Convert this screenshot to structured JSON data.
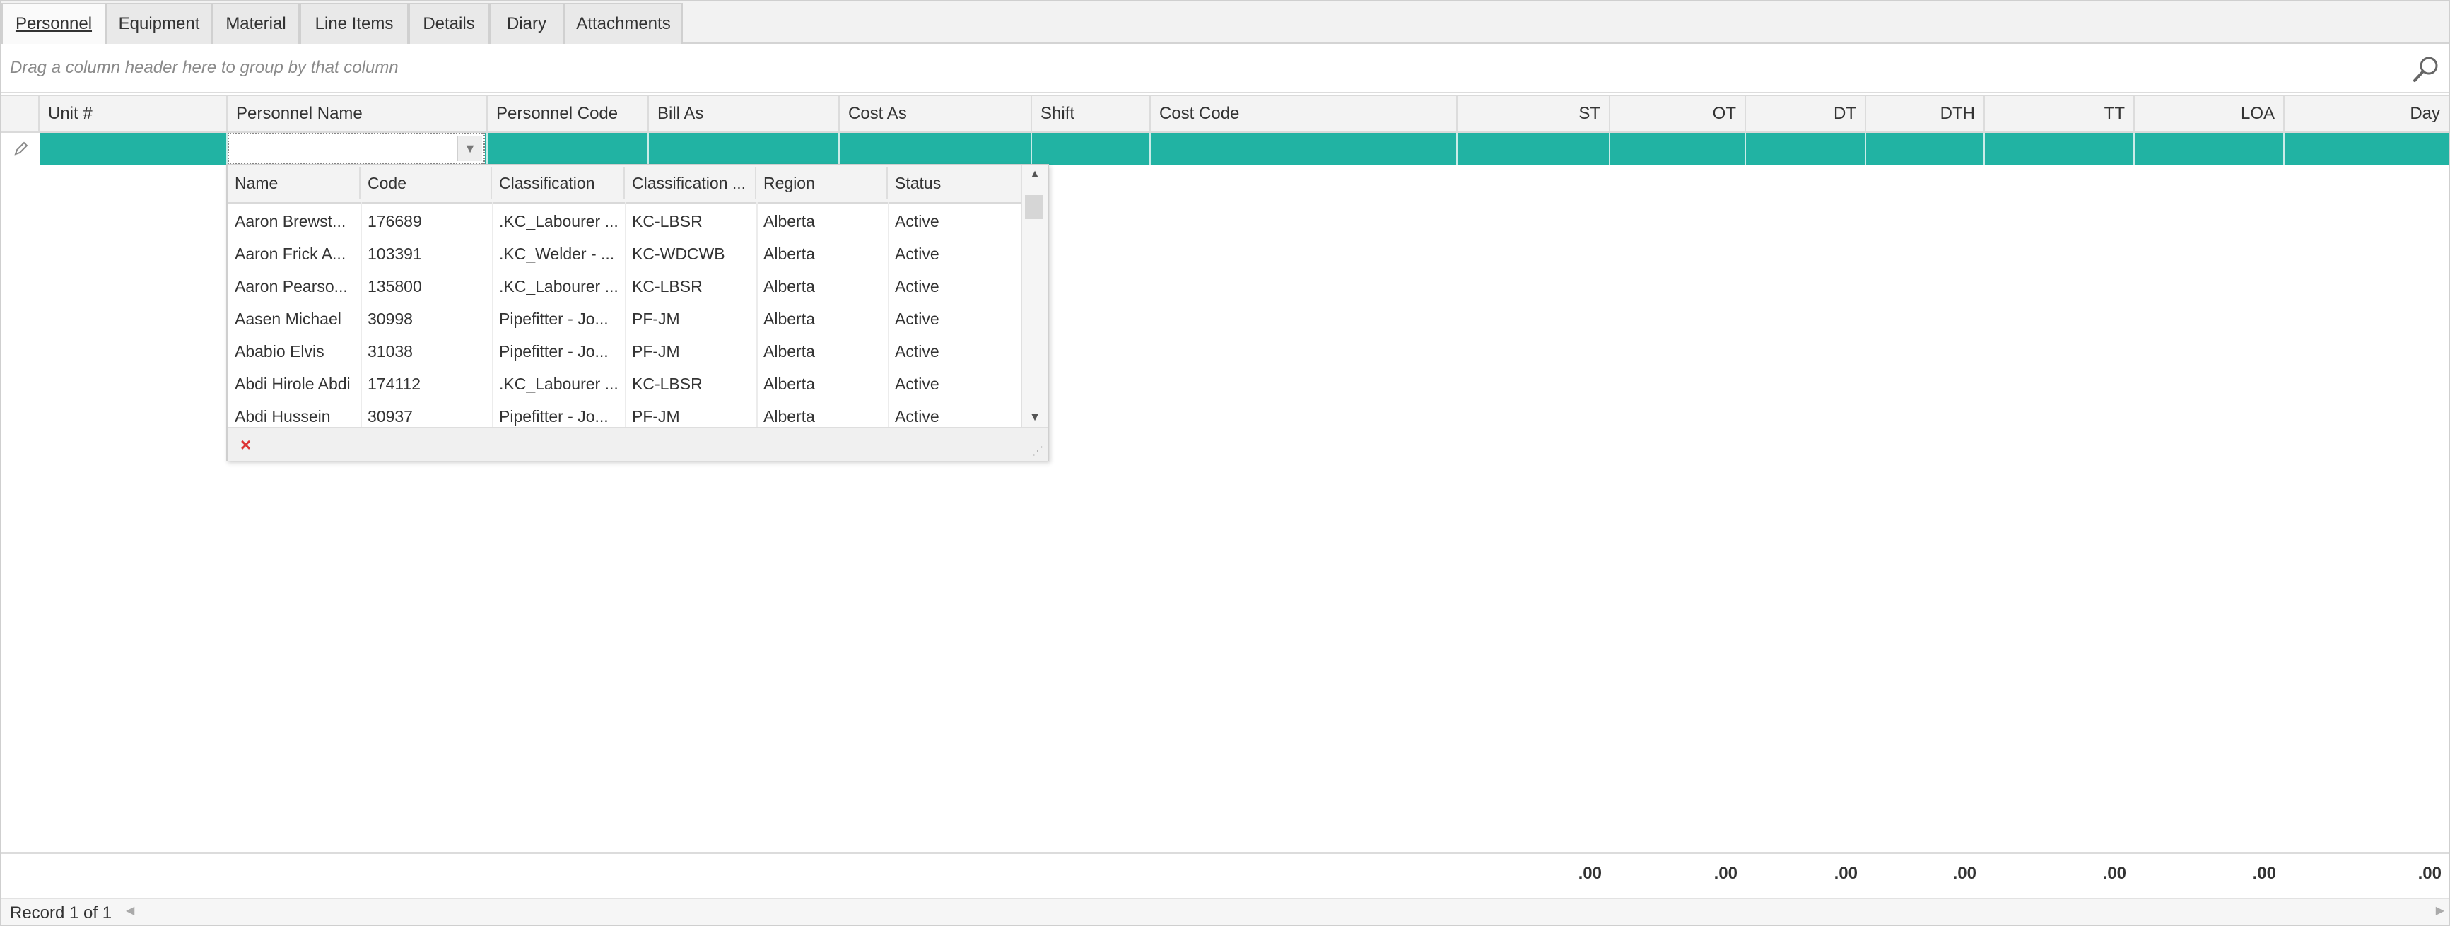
{
  "tabs": [
    {
      "label": "Personnel",
      "active": true
    },
    {
      "label": "Equipment",
      "active": false
    },
    {
      "label": "Material",
      "active": false
    },
    {
      "label": "Line Items",
      "active": false
    },
    {
      "label": "Details",
      "active": false
    },
    {
      "label": "Diary",
      "active": false
    },
    {
      "label": "Attachments",
      "active": false
    }
  ],
  "group_panel": {
    "hint": "Drag a column header here to group by that column"
  },
  "grid": {
    "columns": [
      "Unit #",
      "Personnel Name",
      "Personnel Code",
      "Bill As",
      "Cost As",
      "Shift",
      "Cost Code",
      "ST",
      "OT",
      "DT",
      "DTH",
      "TT",
      "LOA",
      "Day"
    ],
    "new_row_color": "#21b3a3"
  },
  "dropdown": {
    "columns": [
      "Name",
      "Code",
      "Classification",
      "Classification ...",
      "Region",
      "Status"
    ],
    "rows": [
      [
        "Aaron Brewst...",
        "176689",
        ".KC_Labourer ...",
        "KC-LBSR",
        "Alberta",
        "Active"
      ],
      [
        "Aaron Frick A...",
        "103391",
        ".KC_Welder - ...",
        "KC-WDCWB",
        "Alberta",
        "Active"
      ],
      [
        "Aaron Pearso...",
        "135800",
        ".KC_Labourer ...",
        "KC-LBSR",
        "Alberta",
        "Active"
      ],
      [
        "Aasen Michael",
        "30998",
        "Pipefitter - Jo...",
        "PF-JM",
        "Alberta",
        "Active"
      ],
      [
        "Ababio Elvis",
        "31038",
        "Pipefitter - Jo...",
        "PF-JM",
        "Alberta",
        "Active"
      ],
      [
        "Abdi Hirole Abdi",
        "174112",
        ".KC_Labourer ...",
        "KC-LBSR",
        "Alberta",
        "Active"
      ],
      [
        "Abdi Hussein",
        "30937",
        "Pipefitter - Jo...",
        "PF-JM",
        "Alberta",
        "Active"
      ]
    ]
  },
  "totals": {
    "ST": ".00",
    "OT": ".00",
    "DT": ".00",
    "DTH": ".00",
    "TT": ".00",
    "LOA": ".00",
    "Day": ".00"
  },
  "status": {
    "record_text": "Record 1 of 1"
  },
  "icons": {
    "search": "search-icon",
    "pencil": "pencil-icon",
    "close": "close-icon"
  }
}
